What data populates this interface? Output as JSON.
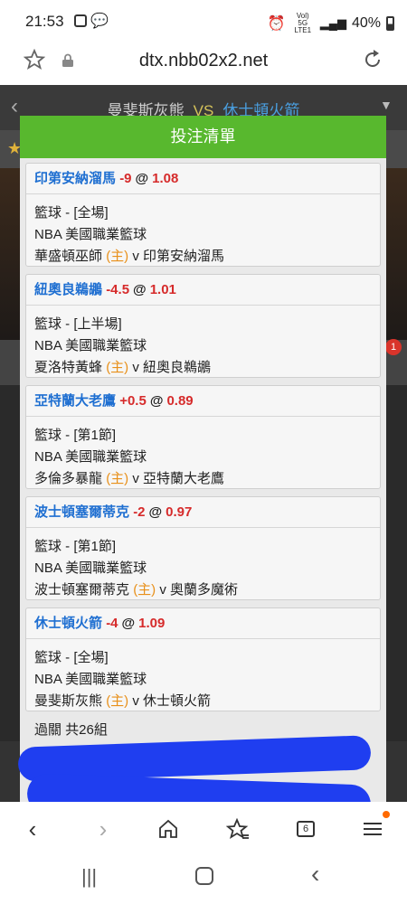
{
  "status_bar": {
    "time": "21:53",
    "signal_text": "Vol) 5G LTE1",
    "battery": "40%"
  },
  "browser": {
    "url": "dtx.nbb02x2.net"
  },
  "match": {
    "home": "曼斐斯灰熊",
    "vs": "VS",
    "away": "休士頓火箭",
    "badge_count": "1"
  },
  "modal": {
    "title": "投注清單",
    "bets": [
      {
        "team": "印第安納溜馬",
        "line": "-9",
        "at": "@",
        "odds": "1.08",
        "market": "籃球 - [全場]",
        "league": "NBA 美國職業籃球",
        "home": "華盛頓巫師",
        "home_tag": "(主)",
        "versus": "v",
        "away": "印第安納溜馬"
      },
      {
        "team": "紐奧良鵜鶘",
        "line": "-4.5",
        "at": "@",
        "odds": "1.01",
        "market": "籃球 - [上半場]",
        "league": "NBA 美國職業籃球",
        "home": "夏洛特黃蜂",
        "home_tag": "(主)",
        "versus": "v",
        "away": "紐奧良鵜鶘"
      },
      {
        "team": "亞特蘭大老鷹",
        "line": "+0.5",
        "at": "@",
        "odds": "0.89",
        "market": "籃球 - [第1節]",
        "league": "NBA 美國職業籃球",
        "home": "多倫多暴龍",
        "home_tag": "(主)",
        "versus": "v",
        "away": "亞特蘭大老鷹"
      },
      {
        "team": "波士頓塞爾蒂克",
        "line": "-2",
        "at": "@",
        "odds": "0.97",
        "market": "籃球 - [第1節]",
        "league": "NBA 美國職業籃球",
        "home": "波士頓塞爾蒂克",
        "home_tag": "(主)",
        "versus": "v",
        "away": "奧蘭多魔術"
      },
      {
        "team": "休士頓火箭",
        "line": "-4",
        "at": "@",
        "odds": "1.09",
        "market": "籃球 - [全場]",
        "league": "NBA 美國職業籃球",
        "home": "曼斐斯灰熊",
        "home_tag": "(主)",
        "versus": "v",
        "away": "休士頓火箭"
      }
    ],
    "summary": "過關 共26組"
  },
  "toolbar": {
    "tab_count": "6"
  },
  "colors": {
    "header_green": "#58b82e",
    "team_blue": "#1f6fd1",
    "odds_red": "#d62b2b",
    "home_orange": "#e8901a",
    "scribble_blue": "#1f3ef0"
  }
}
